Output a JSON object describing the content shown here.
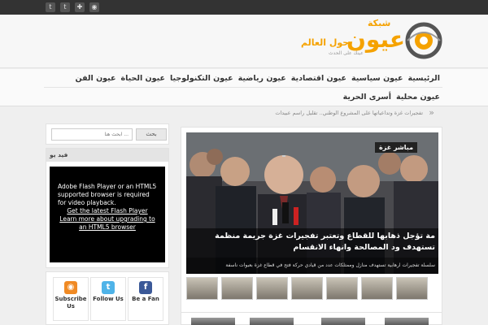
{
  "topbar": {
    "icons": [
      "rss-icon",
      "plus-icon",
      "twitter-icon",
      "twitter-icon"
    ]
  },
  "logo": {
    "network": "شبكة",
    "name": "عيون",
    "around_world": "حول العالم",
    "tagline": "عينك على الحدث"
  },
  "nav": {
    "row1": [
      "الرئيسية",
      "عيون سياسية",
      "عيون اقتصادية",
      "عيون رياضية",
      "عيون التكنولوجيا",
      "عيون الحياة",
      "عيون الفن"
    ],
    "row2": [
      "عيون محلية",
      "أسرى الحرية"
    ]
  },
  "breaking": {
    "text": "تفجيرات غزة وتداعياتها على المشروع الوطني.. تقليل راسم عبيدات",
    "arrow": "»"
  },
  "featured": {
    "live_badge": "مباشر غزة",
    "title": "مة تؤجل ذهابها للقطاع وتعتبر تفجيرات غزة جريمة منظمة تستهدف ود المصالحة وانهاء الانقسام",
    "subtitle": "سلسلة تفجيرات ارهابية تستهدف منازل وممتلكات عدد من قيادي حركة فتح في قطاع غزة بعبوات ناسفة"
  },
  "sidebar": {
    "search_placeholder": "ابحث هنا ...",
    "search_button": "بحث",
    "video_header": "فيد يو",
    "flash": {
      "line1": "Adobe Flash Player or an HTML5 supported browser is required for video playback.",
      "link1": "Get the latest Flash Player",
      "link2": "Learn more about upgrading to an HTML5 browser"
    },
    "social": [
      {
        "label": "Subscribe Us",
        "icon": "rss-icon",
        "color": "#f08a24"
      },
      {
        "label": "Follow Us",
        "icon": "twitter-icon",
        "color": "#4fb3e8"
      },
      {
        "label": "Be a Fan",
        "icon": "facebook-icon",
        "color": "#3b5998"
      }
    ]
  },
  "colors": {
    "accent": "#f5a200",
    "topbar": "#333333"
  }
}
